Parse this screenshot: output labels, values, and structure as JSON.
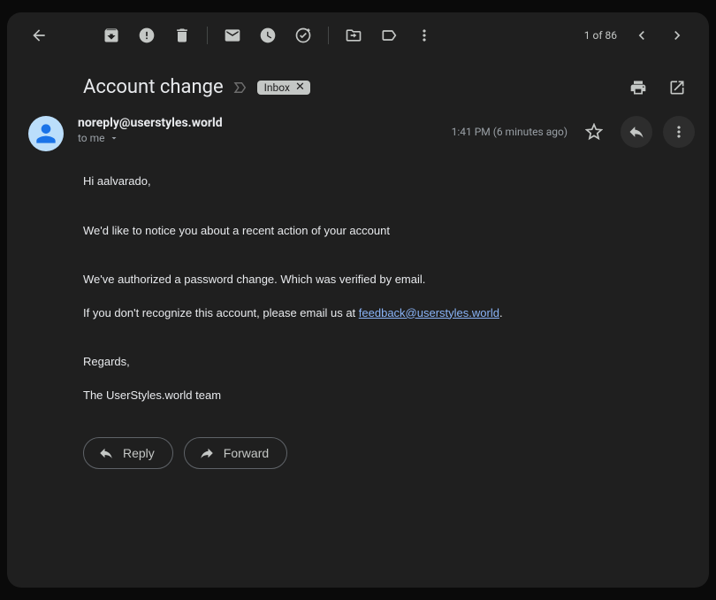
{
  "toolbar": {
    "counter": "1 of 86"
  },
  "subject": {
    "title": "Account change",
    "label": "Inbox"
  },
  "sender": {
    "name": "noreply@userstyles.world",
    "to": "to me"
  },
  "meta": {
    "time": "1:41 PM (6 minutes ago)"
  },
  "body": {
    "greeting": "Hi aalvarado,",
    "line1": "We'd like to notice you about a recent action of your account",
    "line2": "We've authorized a password change. Which was verified by email.",
    "line3a": "If you don't recognize this account, please email us at ",
    "link": "feedback@userstyles.world",
    "line3b": ".",
    "regards": "Regards,",
    "team": "The UserStyles.world team"
  },
  "actions": {
    "reply": "Reply",
    "forward": "Forward"
  }
}
